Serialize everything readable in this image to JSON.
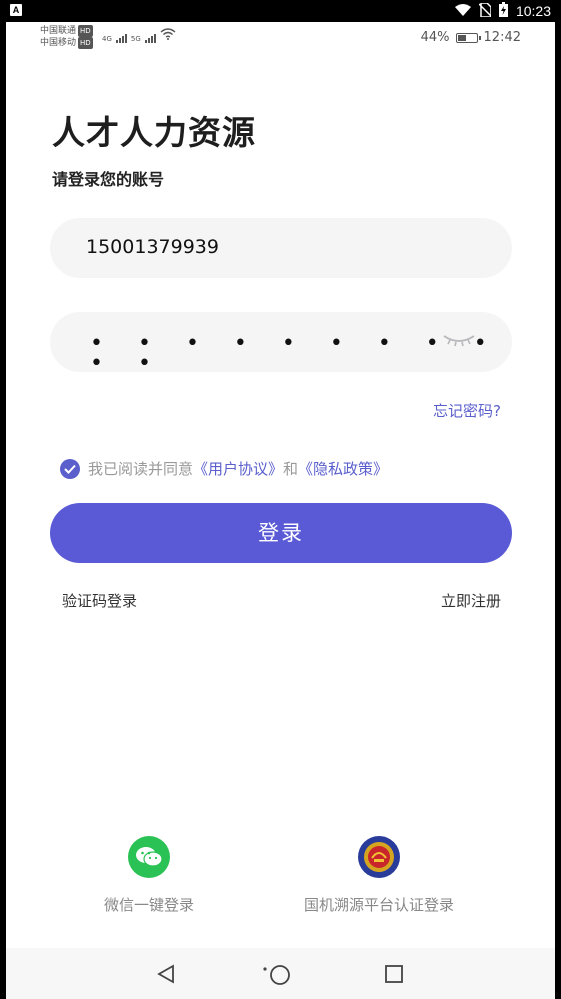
{
  "system_bar": {
    "time": "10:23",
    "app_badge": "A"
  },
  "phone_status": {
    "carrier1": "中国联通",
    "carrier2": "中国移动",
    "hd": "HD",
    "net1": "4G",
    "net2": "5G",
    "battery": "44%",
    "battery_level": 0.44,
    "time": "12:42"
  },
  "header": {
    "title": "人才人力资源",
    "subtitle": "请登录您的账号"
  },
  "form": {
    "phone_value": "15001379939",
    "password_mask": "• • • • • • • • • • •",
    "forgot_label": "忘记密码?",
    "agree_prefix": "我已阅读并同意",
    "user_agreement": "《用户协议》",
    "and_text": "和",
    "privacy_policy": "《隐私政策》",
    "agree_checked": true,
    "login_label": "登录",
    "sms_login_label": "验证码登录",
    "register_label": "立即注册"
  },
  "third_party": {
    "wechat_label": "微信一键登录",
    "gov_label": "国机溯源平台认证登录"
  },
  "colors": {
    "accent": "#5a5ad6",
    "link": "#5a5fcc",
    "wechat": "#2bc255"
  }
}
